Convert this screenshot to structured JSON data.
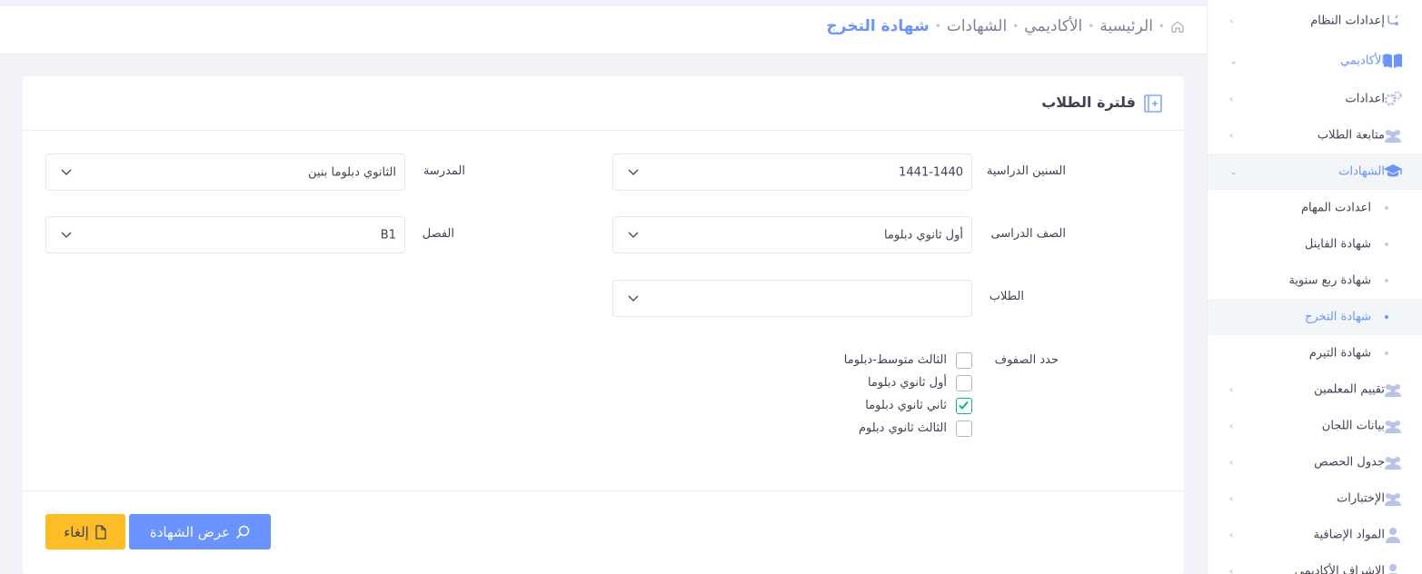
{
  "colors": {
    "accent": "#6993ff",
    "warning": "#fdbd24",
    "check": "#0bb783"
  },
  "sidebar": {
    "items": [
      {
        "label": "إعدادات النظام",
        "icon": "settings-icon",
        "chevron": "›"
      },
      {
        "label": "الأكاديمي",
        "icon": "book-icon",
        "chevron": "⌄"
      },
      {
        "label": "اعدادات",
        "icon": "gears-icon",
        "chevron": "›"
      },
      {
        "label": "متابعة الطلاب",
        "icon": "users-icon",
        "chevron": "›"
      },
      {
        "label": "الشهادات",
        "icon": "graduation-cap-icon",
        "chevron": "⌄"
      },
      {
        "label": "اعدادت المهام",
        "icon": "dot-icon"
      },
      {
        "label": "شهادة الفاينل",
        "icon": "dot-icon"
      },
      {
        "label": "شهادة ربع سنوية",
        "icon": "dot-icon"
      },
      {
        "label": "شهادة التخرج",
        "icon": "dot-icon"
      },
      {
        "label": "شهادة التيرم",
        "icon": "dot-icon"
      },
      {
        "label": "تقييم المعلمين",
        "icon": "users-icon",
        "chevron": "›"
      },
      {
        "label": "بيانات اللجان",
        "icon": "users-icon",
        "chevron": "›"
      },
      {
        "label": "جدول الحصص",
        "icon": "users-icon",
        "chevron": "›"
      },
      {
        "label": "الإختبارات",
        "icon": "users-icon",
        "chevron": "›"
      },
      {
        "label": "المواد الإضافية",
        "icon": "user-icon",
        "chevron": "›"
      },
      {
        "label": "الإشراف الأكاديمي",
        "icon": "user-icon",
        "chevron": "›"
      }
    ]
  },
  "breadcrumb": {
    "home_icon": "home-icon",
    "items": [
      "الرئيسية",
      "الأكاديمي",
      "الشهادات"
    ],
    "current": "شهادة التخرج"
  },
  "filter": {
    "title": "فلترة الطلاب",
    "title_icon": "plus-square-icon",
    "fields": {
      "years": {
        "label": "السنين الدراسية",
        "value": "1441-1440"
      },
      "school": {
        "label": "المدرسة",
        "value": "الثانوي دبلوما بنين"
      },
      "grade": {
        "label": "الصف الدراسى",
        "value": "أول ثانوي دبلوما"
      },
      "class": {
        "label": "الفصل",
        "value": "B1"
      },
      "student": {
        "label": "الطلاب",
        "value": ""
      }
    },
    "grades_select": {
      "label": "حدد الصفوف",
      "options": [
        {
          "label": "الثالث متوسط-دبلوما",
          "checked": false
        },
        {
          "label": "أول ثانوي دبلوما",
          "checked": false
        },
        {
          "label": "ثاني ثانوي دبلوما",
          "checked": true
        },
        {
          "label": "الثالث ثانوي دبلوم",
          "checked": false
        }
      ]
    }
  },
  "buttons": {
    "show": {
      "label": "عرض الشهادة",
      "icon": "search-icon"
    },
    "cancel": {
      "label": "إلغاء",
      "icon": "file-icon"
    }
  }
}
